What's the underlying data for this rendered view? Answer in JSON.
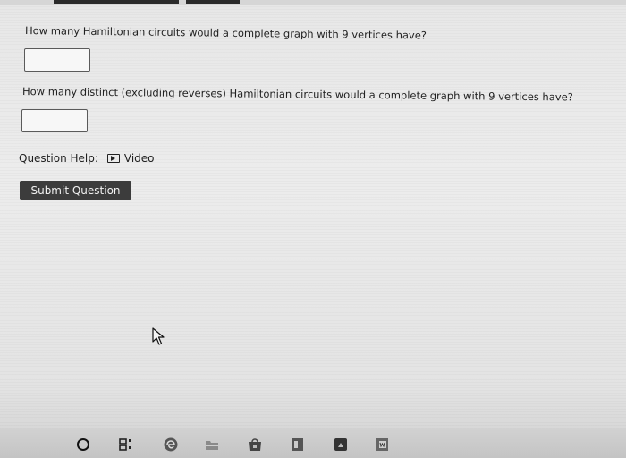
{
  "questions": [
    {
      "text": "How many Hamiltonian circuits would a complete graph with 9 vertices have?",
      "answer": ""
    },
    {
      "text": "How many distinct (excluding reverses) Hamiltonian circuits would a complete graph with 9 vertices have?",
      "answer": ""
    }
  ],
  "help": {
    "label": "Question Help:",
    "video_label": "Video"
  },
  "submit_label": "Submit Question",
  "taskbar": {
    "icons": [
      "start-circle-icon",
      "task-view-icon",
      "edge-browser-icon",
      "file-explorer-icon",
      "store-icon",
      "notes-app-icon",
      "photos-app-icon",
      "word-icon"
    ]
  }
}
